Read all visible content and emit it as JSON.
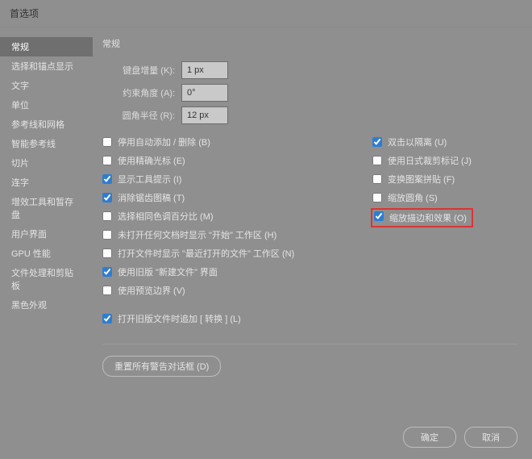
{
  "window": {
    "title": "首选项"
  },
  "sidebar": {
    "items": [
      {
        "label": "常规",
        "selected": true
      },
      {
        "label": "选择和锚点显示"
      },
      {
        "label": "文字"
      },
      {
        "label": "单位"
      },
      {
        "label": "参考线和网格"
      },
      {
        "label": "智能参考线"
      },
      {
        "label": "切片"
      },
      {
        "label": "连字"
      },
      {
        "label": "增效工具和暂存盘"
      },
      {
        "label": "用户界面"
      },
      {
        "label": "GPU 性能"
      },
      {
        "label": "文件处理和剪贴板"
      },
      {
        "label": "黑色外观"
      }
    ]
  },
  "section": {
    "title": "常规"
  },
  "fields": {
    "key_increment": {
      "label": "键盘增量 (K):",
      "value": "1 px"
    },
    "constrain_angle": {
      "label": "约束角度 (A):",
      "value": "0°"
    },
    "corner_radius": {
      "label": "圆角半径 (R):",
      "value": "12 px"
    }
  },
  "left": [
    {
      "label": "停用自动添加 / 删除 (B)",
      "checked": false
    },
    {
      "label": "使用精确光标 (E)",
      "checked": false
    },
    {
      "label": "显示工具提示 (I)",
      "checked": true
    },
    {
      "label": "消除锯齿图稿 (T)",
      "checked": true
    },
    {
      "label": "选择相同色调百分比 (M)",
      "checked": false
    },
    {
      "label": "未打开任何文档时显示 \"开始\" 工作区 (H)",
      "checked": false
    },
    {
      "label": "打开文件时显示 \"最近打开的文件\" 工作区 (N)",
      "checked": false
    },
    {
      "label": "使用旧版 \"新建文件\" 界面",
      "checked": true
    },
    {
      "label": "使用预览边界 (V)",
      "checked": false
    }
  ],
  "left2": [
    {
      "label": "打开旧版文件时追加 [ 转换 ] (L)",
      "checked": true
    }
  ],
  "right": [
    {
      "label": "双击以隔离 (U)",
      "checked": true
    },
    {
      "label": "使用日式裁剪标记 (J)",
      "checked": false
    },
    {
      "label": "变换图案拼贴 (F)",
      "checked": false
    },
    {
      "label": "缩放圆角 (S)",
      "checked": false
    },
    {
      "label": "缩放描边和效果 (O)",
      "checked": true,
      "highlight": true
    }
  ],
  "buttons": {
    "reset": "重置所有警告对话框 (D)",
    "ok": "确定",
    "cancel": "取消"
  }
}
